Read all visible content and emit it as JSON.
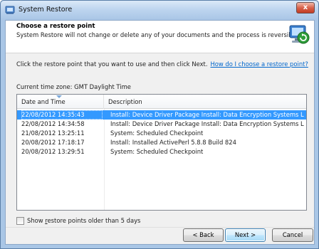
{
  "window": {
    "title": "System Restore",
    "close_glyph": "x"
  },
  "header": {
    "title": "Choose a restore point",
    "subtitle": "System Restore will not change or delete any of your documents and the process is reversible.",
    "icon": "system-restore-icon"
  },
  "instruction": {
    "text": "Click the restore point that you want to use and then click Next.",
    "help_link": "How do I choose a restore point?"
  },
  "timezone": "Current time zone: GMT Daylight Time",
  "table": {
    "columns": [
      "Date and Time",
      "Description"
    ],
    "rows": [
      {
        "date": "22/08/2012 14:35:43",
        "description": "Install: Device Driver Package Install: Data Encryption Systems Limited...",
        "selected": true
      },
      {
        "date": "22/08/2012 14:34:58",
        "description": "Install: Device Driver Package Install: Data Encryption Systems Limited..."
      },
      {
        "date": "21/08/2012 13:25:11",
        "description": "System: Scheduled Checkpoint"
      },
      {
        "date": "20/08/2012 17:18:17",
        "description": "Install: Installed ActivePerl 5.8.8 Build 824"
      },
      {
        "date": "20/08/2012 13:29:51",
        "description": "System: Scheduled Checkpoint"
      }
    ]
  },
  "show_older": {
    "label_pre": "Show ",
    "label_accel": "r",
    "label_post": "estore points older than 5 days",
    "checked": false
  },
  "buttons": {
    "back": "< Back",
    "next": "Next >",
    "cancel": "Cancel"
  },
  "colors": {
    "selection": "#3399ff",
    "link": "#0066cc",
    "frame": "#a9c6e6"
  }
}
